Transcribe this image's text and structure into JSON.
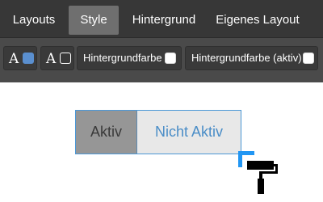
{
  "tabs": [
    {
      "label": "Layouts",
      "active": false
    },
    {
      "label": "Style",
      "active": true
    },
    {
      "label": "Hintergrund",
      "active": false
    },
    {
      "label": "Eigenes Layout",
      "active": false
    }
  ],
  "toolbar": {
    "font_color_active": {
      "glyph": "A",
      "swatch_color": "#5a8fcf"
    },
    "font_color_inactive": {
      "glyph": "A",
      "swatch_color": "#ffffff"
    },
    "background_color": {
      "label": "Hintergrundfarbe",
      "swatch_color": "#ffffff"
    },
    "background_color_active": {
      "label": "Hintergrundfarbe (aktiv)",
      "swatch_color": "#ffffff"
    }
  },
  "preview": {
    "active_label": "Aktiv",
    "inactive_label": "Nicht Aktiv"
  },
  "colors": {
    "tabbar_bg": "#373737",
    "toolbar_bg": "#4a4a4a",
    "active_tab_bg": "#6f6f6f",
    "accent": "#2196f3",
    "inactive_text": "#4a8dc7"
  },
  "icons": {
    "resize_handle": "resize-corner-icon",
    "cursor": "paint-roller-icon"
  }
}
